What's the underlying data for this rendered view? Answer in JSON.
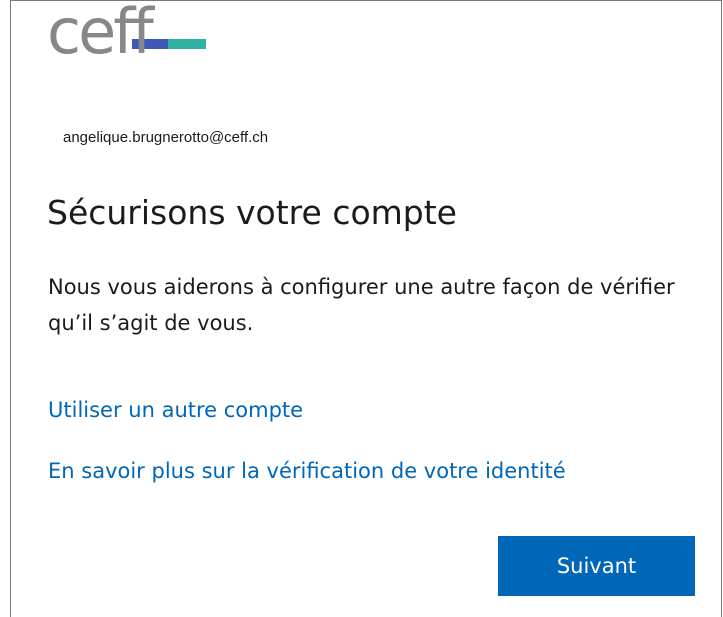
{
  "logo": {
    "text": "ceff",
    "colors": {
      "text": "#858789",
      "bar_left": "#3f59b8",
      "bar_right": "#30b2a3"
    }
  },
  "account": {
    "email": "angelique.brugnerotto@ceff.ch"
  },
  "heading": "Sécurisons votre compte",
  "description": "Nous vous aiderons à configurer une autre façon de vérifier qu’il s’agit de vous.",
  "links": {
    "other_account": "Utiliser un autre compte",
    "learn_more": "En savoir plus sur la vérification de votre identité"
  },
  "buttons": {
    "next": "Suivant"
  },
  "colors": {
    "accent": "#0067b8",
    "text": "#1b1b1b",
    "background": "#ffffff"
  }
}
